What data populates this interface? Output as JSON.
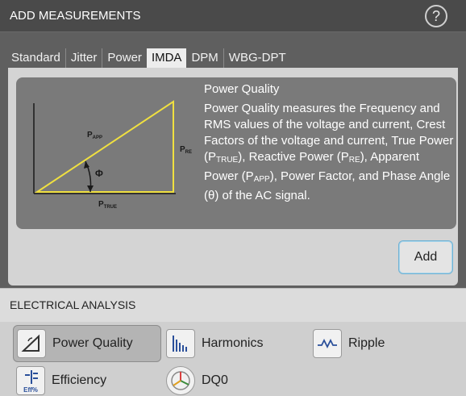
{
  "dialog": {
    "title": "ADD MEASUREMENTS",
    "help_symbol": "?"
  },
  "tabs": [
    {
      "label": "Standard",
      "active": false
    },
    {
      "label": "Jitter",
      "active": false
    },
    {
      "label": "Power",
      "active": false
    },
    {
      "label": "IMDA",
      "active": true
    },
    {
      "label": "DPM",
      "active": false
    },
    {
      "label": "WBG-DPT",
      "active": false
    }
  ],
  "info": {
    "title": "Power Quality",
    "description": {
      "p1": "Power Quality measures the Frequency and RMS values of the voltage and current, Crest Factors of the voltage and current, True Power (P",
      "s1": "TRUE",
      "p2": "), Reactive Power (P",
      "s2": "RE",
      "p3": "), Apparent Power (P",
      "s3": "APP",
      "p4": "), Power Factor, and Phase Angle (θ) of the AC signal."
    },
    "diagram": {
      "p_app_main": "P",
      "p_app_sub": "APP",
      "p_re_main": "P",
      "p_re_sub": "RE",
      "p_true_main": "P",
      "p_true_sub": "TRUE",
      "angle_symbol": "Φ",
      "triangle_color": "#f0e040"
    }
  },
  "add_button_label": "Add",
  "section": {
    "title": "ELECTRICAL ANALYSIS",
    "items": [
      {
        "label": "Power Quality",
        "icon": "power-quality-icon",
        "selected": true
      },
      {
        "label": "Harmonics",
        "icon": "harmonics-icon",
        "selected": false
      },
      {
        "label": "Ripple",
        "icon": "ripple-icon",
        "selected": false
      },
      {
        "label": "Efficiency",
        "icon": "efficiency-icon",
        "icon_text": "Eff%",
        "selected": false
      },
      {
        "label": "DQ0",
        "icon": "dq0-icon",
        "selected": false
      }
    ]
  },
  "colors": {
    "accent_border": "#6fb2d4",
    "diagram_line": "#f0e040"
  }
}
